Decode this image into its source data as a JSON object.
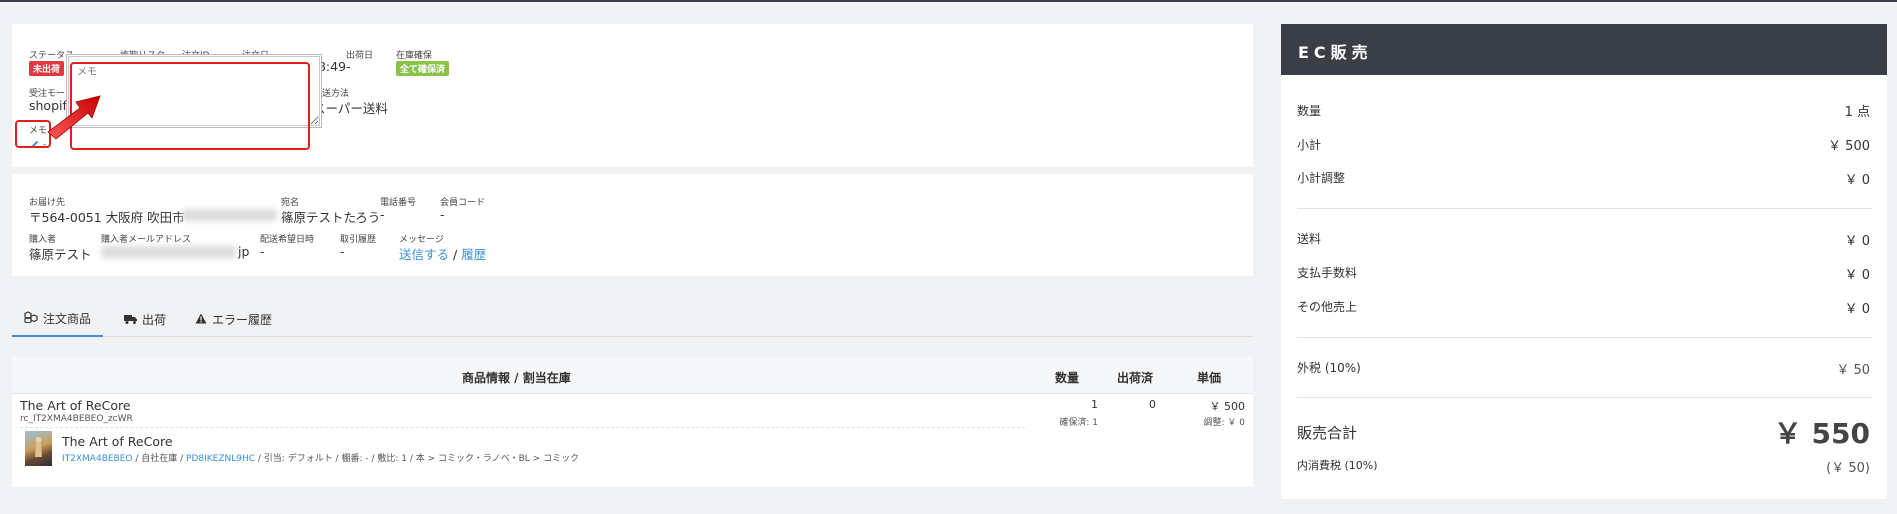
{
  "order": {
    "status_label": "ステータス",
    "status_badge": "未出荷",
    "fraud_label": "詐欺リスク",
    "order_id_label": "注文ID",
    "order_date_label": "注文日",
    "order_time": "08:49",
    "ship_date_label": "出荷日",
    "ship_date": "-",
    "stock_label": "在庫確保",
    "stock_badge": "全て確保済",
    "source_label": "受注モー",
    "source_value": "shopif",
    "delivery_method_label": "配送方法",
    "delivery_method": "スーパー送料",
    "memo_label": "メモ",
    "memo_dash": "-",
    "memo_placeholder": "メモ"
  },
  "customer": {
    "address_label": "お届け先",
    "address": "〒564-0051 大阪府 吹田市",
    "recipient_label": "宛名",
    "recipient": "篠原テストたろう",
    "phone_label": "電話番号",
    "phone": "-",
    "member_label": "会員コード",
    "member": "-",
    "buyer_label": "購入者",
    "buyer": "篠原テスト",
    "email_label": "購入者メールアドレス",
    "email_tail": "jp",
    "desired_date_label": "配送希望日時",
    "desired_date": "-",
    "history_label": "取引履歴",
    "history": "-",
    "message_label": "メッセージ",
    "message_send": "送信する",
    "message_sep": " / ",
    "message_history": "履歴"
  },
  "tabs": [
    {
      "label": "注文商品"
    },
    {
      "label": "出荷"
    },
    {
      "label": "エラー履歴"
    }
  ],
  "table": {
    "headers": {
      "product": "商品情報 / 割当在庫",
      "qty": "数量",
      "shipped": "出荷済",
      "price": "単価"
    },
    "row": {
      "name": "The Art of ReCore",
      "code": "rc_IT2XMA4BEBEO_zcWR",
      "qty": "1",
      "reserved": "確保済: 1",
      "shipped": "0",
      "price": "￥ 500",
      "adjust": "調整: ￥ 0",
      "stock_name": "The Art of ReCore",
      "stock_code": "IT2XMA4BEBEO",
      "stock_own": " / 自社在庫 / ",
      "stock_link": "PD8IKEZNL9HC",
      "stock_detail": " / 引当: デフォルト / 棚番: - / 敷比: 1 / 本 > コミック・ラノベ・BL > コミック"
    }
  },
  "summary": {
    "title": "EC販売",
    "qty_label": "数量",
    "qty_value": "1 点",
    "subtotal_label": "小計",
    "subtotal_value": "￥ 500",
    "subtotal_adj_label": "小計調整",
    "subtotal_adj_value": "￥ 0",
    "shipping_label": "送料",
    "shipping_value": "￥ 0",
    "fee_label": "支払手数料",
    "fee_value": "￥ 0",
    "other_label": "その他売上",
    "other_value": "￥ 0",
    "tax_label": "外税 (10%)",
    "tax_value": "￥ 50",
    "total_label": "販売合計",
    "total_value": "￥ 550",
    "incl_tax_label": "内消費税 (10%)",
    "incl_tax_value": "(￥ 50)"
  },
  "colors": {
    "accent": "#3a8fd8",
    "status_red": "#e0383e",
    "stock_green": "#8bc34a",
    "header_dark": "#3a3f47",
    "annotation_red": "#e02020"
  }
}
